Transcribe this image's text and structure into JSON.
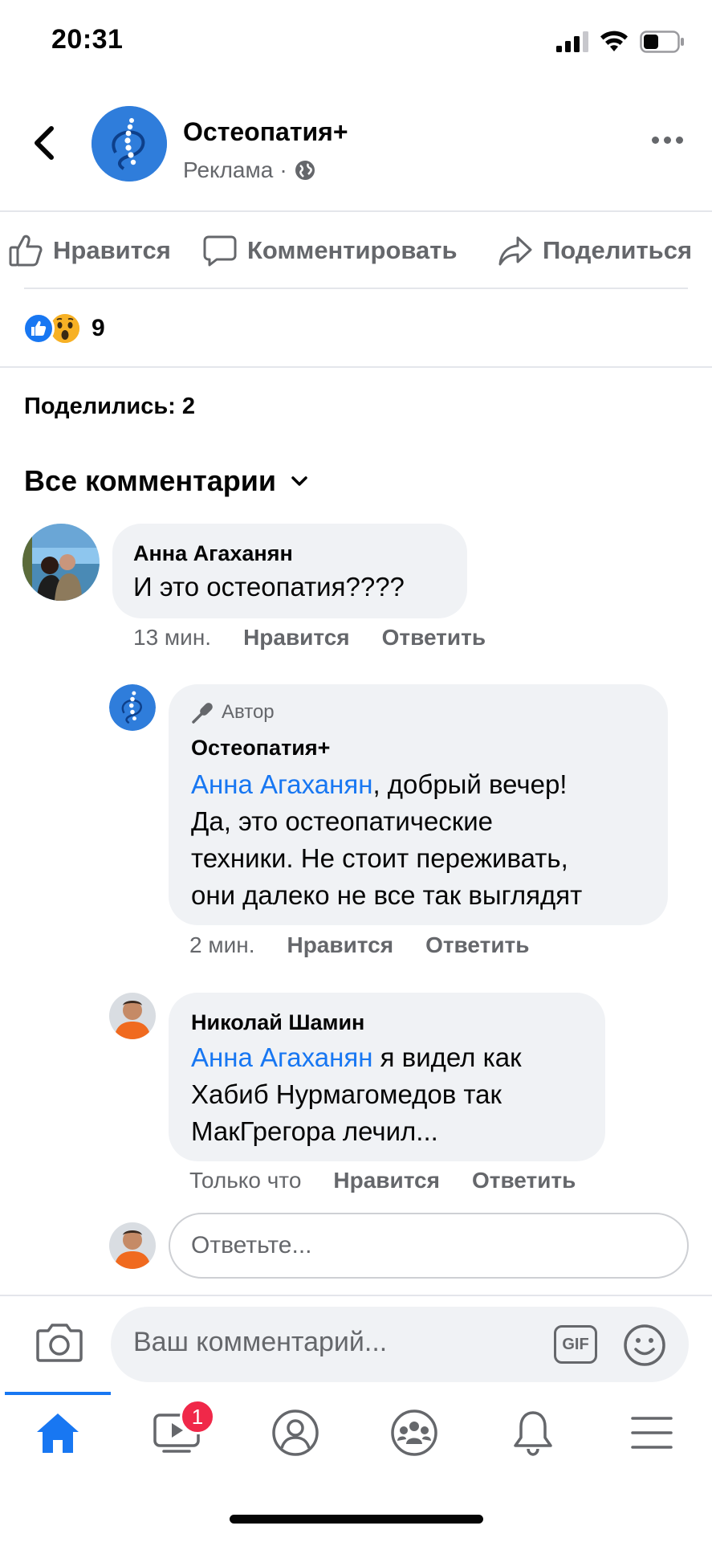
{
  "status_bar": {
    "time": "20:31"
  },
  "header": {
    "page_name": "Остеопатия+",
    "sponsored_label": "Реклама",
    "separator": "·"
  },
  "actions": {
    "like_label": "Нравится",
    "comment_label": "Комментировать",
    "share_label": "Поделиться"
  },
  "reactions": {
    "count": "9"
  },
  "shares": {
    "label": "Поделились: 2"
  },
  "comments_filter": {
    "label": "Все комментарии"
  },
  "comments": [
    {
      "author": "Анна Агаханян",
      "text": "И это остеопатия????",
      "time": "13 мин.",
      "like": "Нравится",
      "reply": "Ответить"
    },
    {
      "author_badge": "Автор",
      "author": "Остеопатия+",
      "mention": "Анна Агаханян",
      "text_after_mention": ", добрый вечер!",
      "line2": "Да, это остеопатические",
      "line3": "техники. Не стоит переживать,",
      "line4": "они далеко не все так выглядят",
      "time": "2 мин.",
      "like": "Нравится",
      "reply": "Ответить"
    },
    {
      "author": "Николай Шамин",
      "mention": "Анна Агаханян",
      "text_after_mention": " я видел как",
      "line2": "Хабиб Нурмагомедов так",
      "line3": "МакГрегора лечил...",
      "time": "Только что",
      "like": "Нравится",
      "reply": "Ответить"
    }
  ],
  "reply_input": {
    "placeholder": "Ответьте..."
  },
  "composer": {
    "placeholder": "Ваш комментарий...",
    "gif_label": "GIF"
  },
  "bottom_nav": {
    "items": [
      "home-icon",
      "video-icon",
      "profile-icon",
      "groups-icon",
      "notifications-icon",
      "menu-icon"
    ],
    "video_badge": "1"
  },
  "colors": {
    "accent": "#1877f2",
    "secondary_text": "#65676b",
    "bubble": "#f0f2f5",
    "badge": "#f02849"
  }
}
